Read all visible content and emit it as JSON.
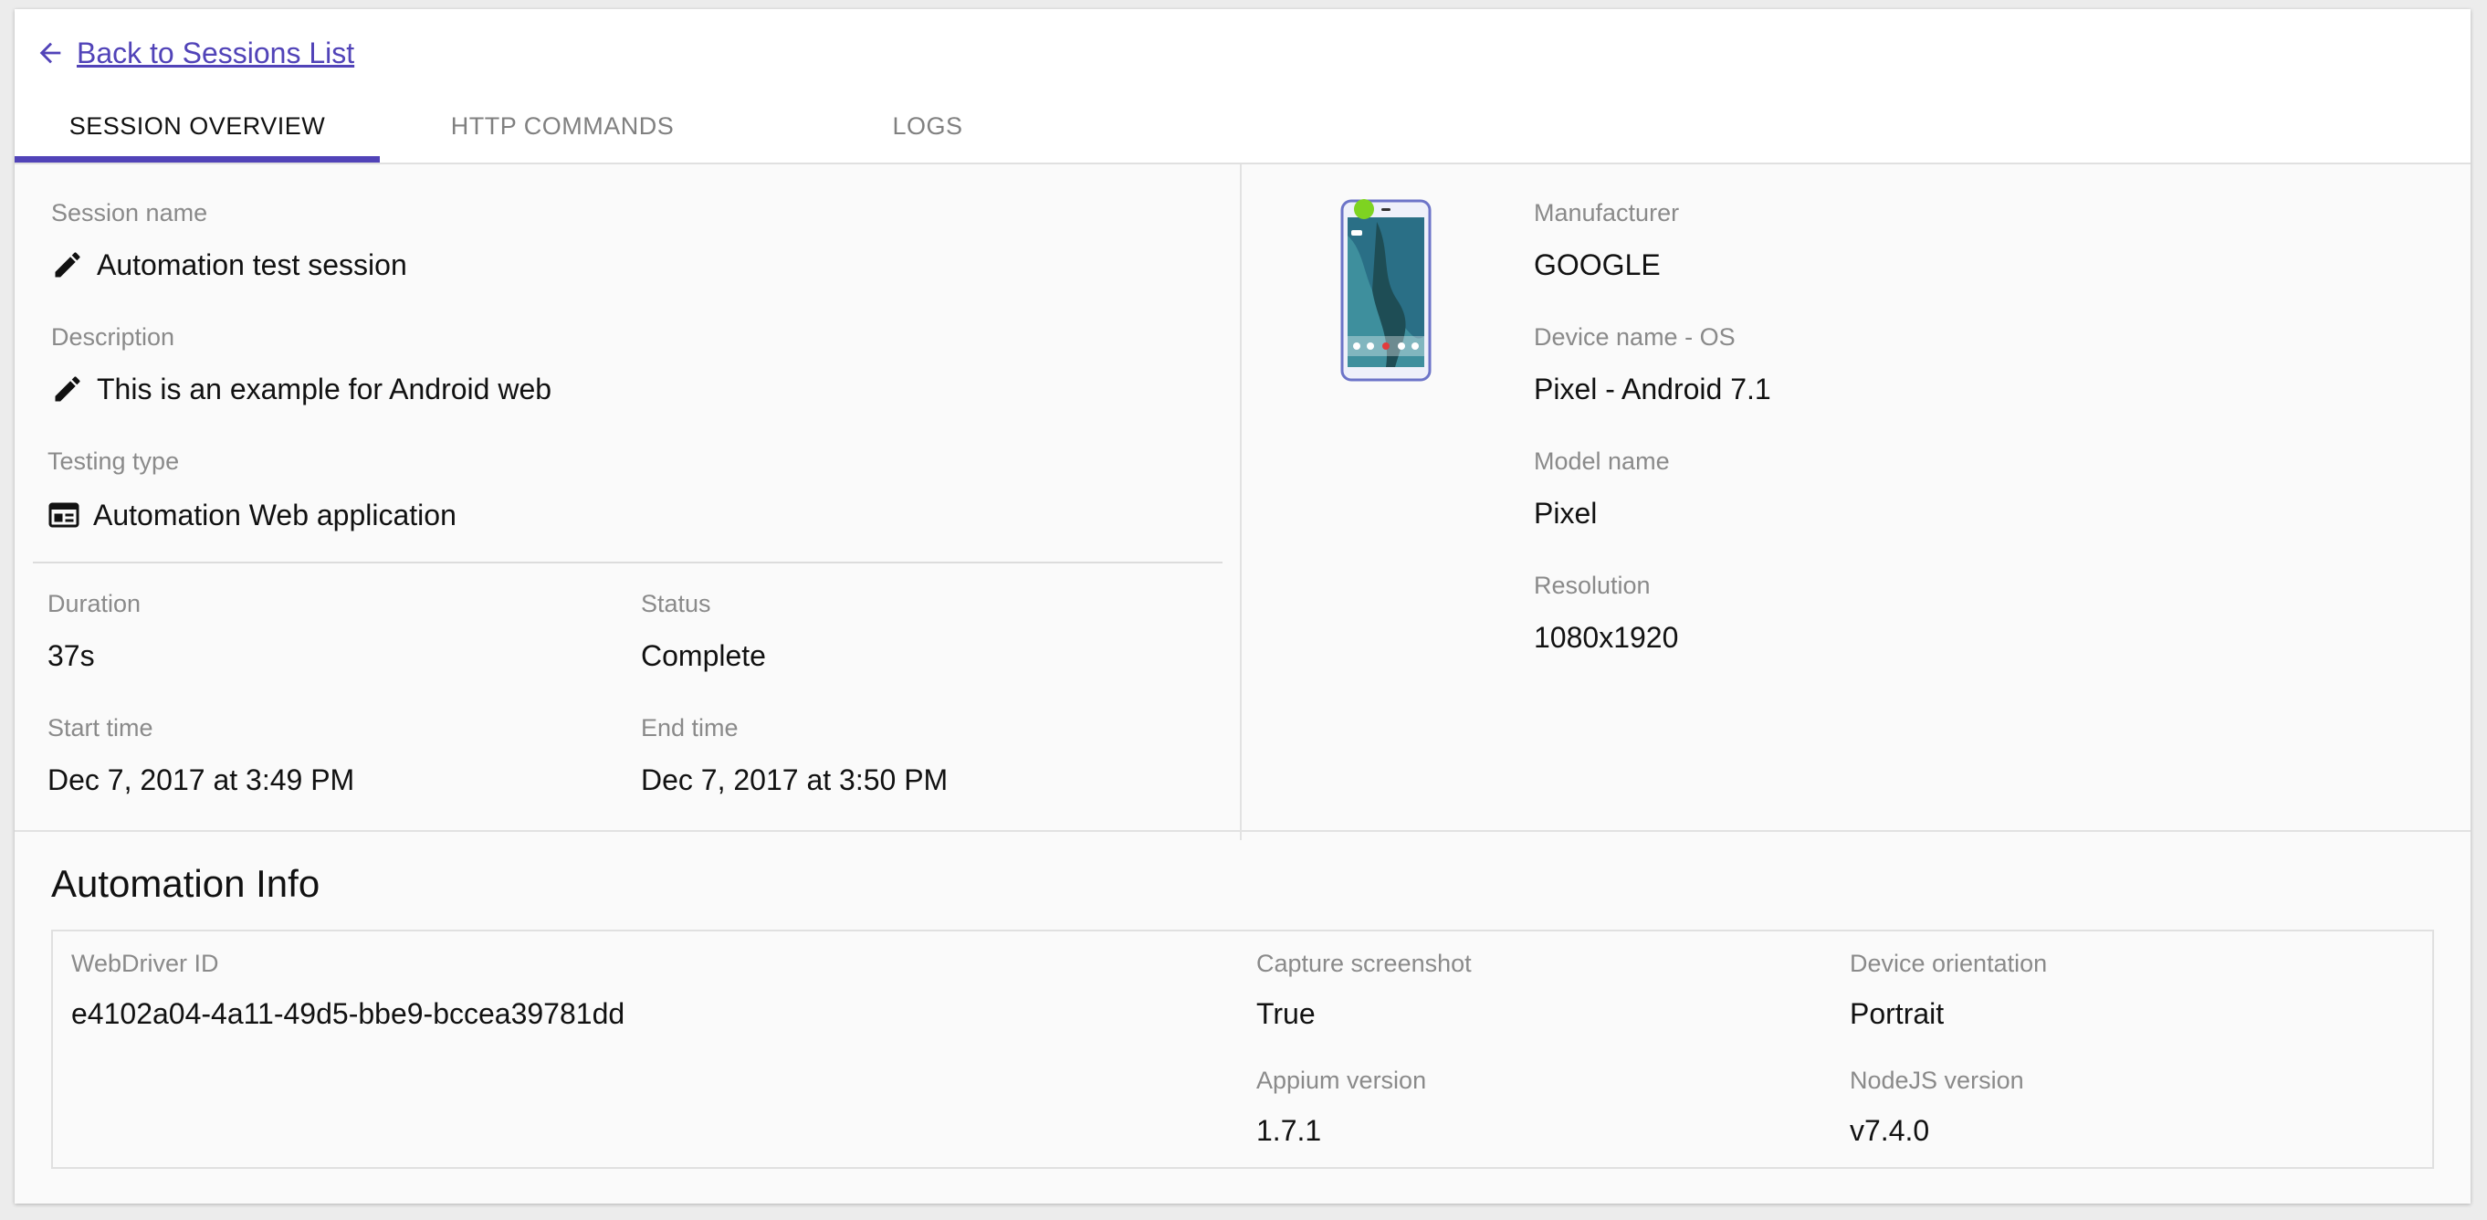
{
  "nav": {
    "back_label": "Back to Sessions List",
    "tabs": [
      {
        "label": "SESSION OVERVIEW"
      },
      {
        "label": "HTTP COMMANDS"
      },
      {
        "label": "LOGS"
      }
    ],
    "active_tab": "SESSION OVERVIEW"
  },
  "colors": {
    "accent": "#5143b8",
    "phone_dot": "#7ed321"
  },
  "session": {
    "name_label": "Session name",
    "name": "Automation test session",
    "description_label": "Description",
    "description": "This is an example for Android web",
    "testing_type_label": "Testing type",
    "testing_type": "Automation Web application",
    "duration_label": "Duration",
    "duration": "37s",
    "status_label": "Status",
    "status": "Complete",
    "start_label": "Start time",
    "start": "Dec 7, 2017 at 3:49 PM",
    "end_label": "End time",
    "end": "Dec 7, 2017 at 3:50 PM"
  },
  "device": {
    "manufacturer_label": "Manufacturer",
    "manufacturer": "GOOGLE",
    "name_os_label": "Device name - OS",
    "name_os": "Pixel - Android 7.1",
    "model_label": "Model name",
    "model": "Pixel",
    "resolution_label": "Resolution",
    "resolution": "1080x1920"
  },
  "automation": {
    "title": "Automation Info",
    "webdriver_label": "WebDriver ID",
    "webdriver": "e4102a04-4a11-49d5-bbe9-bccea39781dd",
    "capture_label": "Capture screenshot",
    "capture": "True",
    "orientation_label": "Device orientation",
    "orientation": "Portrait",
    "appium_label": "Appium version",
    "appium": "1.7.1",
    "nodejs_label": "NodeJS version",
    "nodejs": "v7.4.0"
  },
  "icons": {
    "back": "arrow-left-icon",
    "edit": "pencil-icon",
    "testing_type": "web-window-icon"
  }
}
